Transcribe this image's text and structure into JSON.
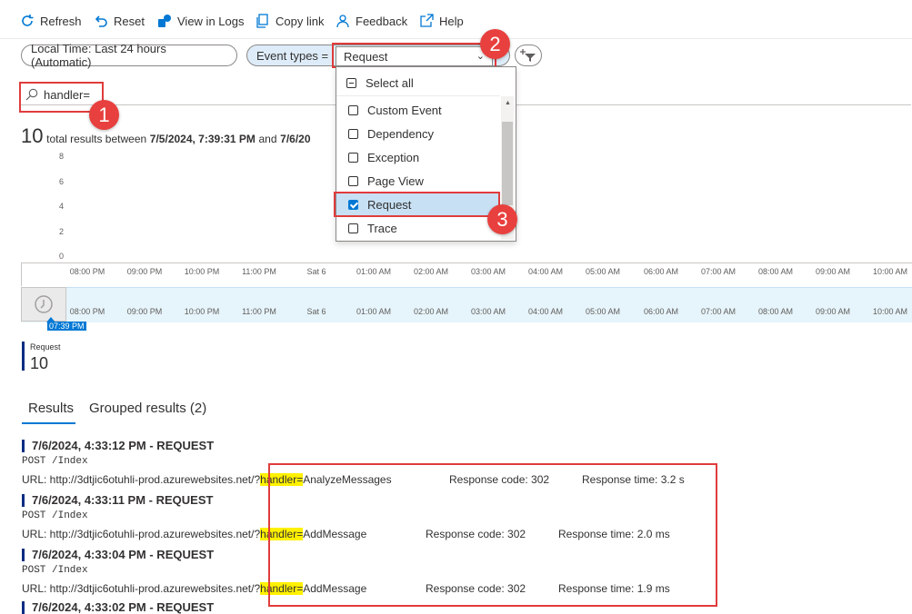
{
  "toolbar": {
    "refresh": "Refresh",
    "reset": "Reset",
    "view_in_logs": "View in Logs",
    "copy_link": "Copy link",
    "feedback": "Feedback",
    "help": "Help"
  },
  "filters": {
    "time": "Local Time: Last 24 hours (Automatic)",
    "event_types_label": "Event types  =",
    "event_types_value": "Request"
  },
  "search": {
    "value": "handler="
  },
  "dropdown": {
    "select_all": "Select all",
    "options": [
      {
        "label": "Custom Event",
        "checked": false
      },
      {
        "label": "Dependency",
        "checked": false
      },
      {
        "label": "Exception",
        "checked": false
      },
      {
        "label": "Page View",
        "checked": false
      },
      {
        "label": "Request",
        "checked": true
      },
      {
        "label": "Trace",
        "checked": false
      }
    ]
  },
  "summary": {
    "count": "10",
    "text": "total results between",
    "start": "7/5/2024, 7:39:31 PM",
    "and": "and",
    "end": "7/6/20"
  },
  "chart_data": {
    "type": "bar",
    "yticks": [
      "8",
      "6",
      "4",
      "2",
      "0"
    ],
    "xticks": [
      "08:00 PM",
      "09:00 PM",
      "10:00 PM",
      "11:00 PM",
      "Sat 6",
      "01:00 AM",
      "02:00 AM",
      "03:00 AM",
      "04:00 AM",
      "05:00 AM",
      "06:00 AM",
      "07:00 AM",
      "08:00 AM",
      "09:00 AM",
      "10:00 AM"
    ],
    "range_start_label": "07:39 PM"
  },
  "legend": {
    "name": "Request",
    "value": "10"
  },
  "tabs": [
    "Results",
    "Grouped results (2)"
  ],
  "results": [
    {
      "title": "7/6/2024, 4:33:12 PM - REQUEST",
      "method": "POST /Index",
      "url_prefix": "URL: http://3dtjic6otuhli-prod.azurewebsites.net/?",
      "url_handler": "handler=",
      "url_suffix": "AnalyzeMessages",
      "response_code": "Response code: 302",
      "response_time": "Response time: 3.2 s"
    },
    {
      "title": "7/6/2024, 4:33:11 PM - REQUEST",
      "method": "POST /Index",
      "url_prefix": "URL: http://3dtjic6otuhli-prod.azurewebsites.net/?",
      "url_handler": "handler=",
      "url_suffix": "AddMessage",
      "response_code": "Response code: 302",
      "response_time": "Response time: 2.0 ms"
    },
    {
      "title": "7/6/2024, 4:33:04 PM - REQUEST",
      "method": "POST /Index",
      "url_prefix": "URL: http://3dtjic6otuhli-prod.azurewebsites.net/?",
      "url_handler": "handler=",
      "url_suffix": "AddMessage",
      "response_code": "Response code: 302",
      "response_time": "Response time: 1.9 ms"
    },
    {
      "title": "7/6/2024, 4:33:02 PM - REQUEST"
    }
  ],
  "callouts": [
    "1",
    "2",
    "3"
  ],
  "colors": {
    "accent": "#0078d4",
    "callout": "#e8403e",
    "highlight": "#fff100",
    "legend_bar": "#0a2d82"
  }
}
